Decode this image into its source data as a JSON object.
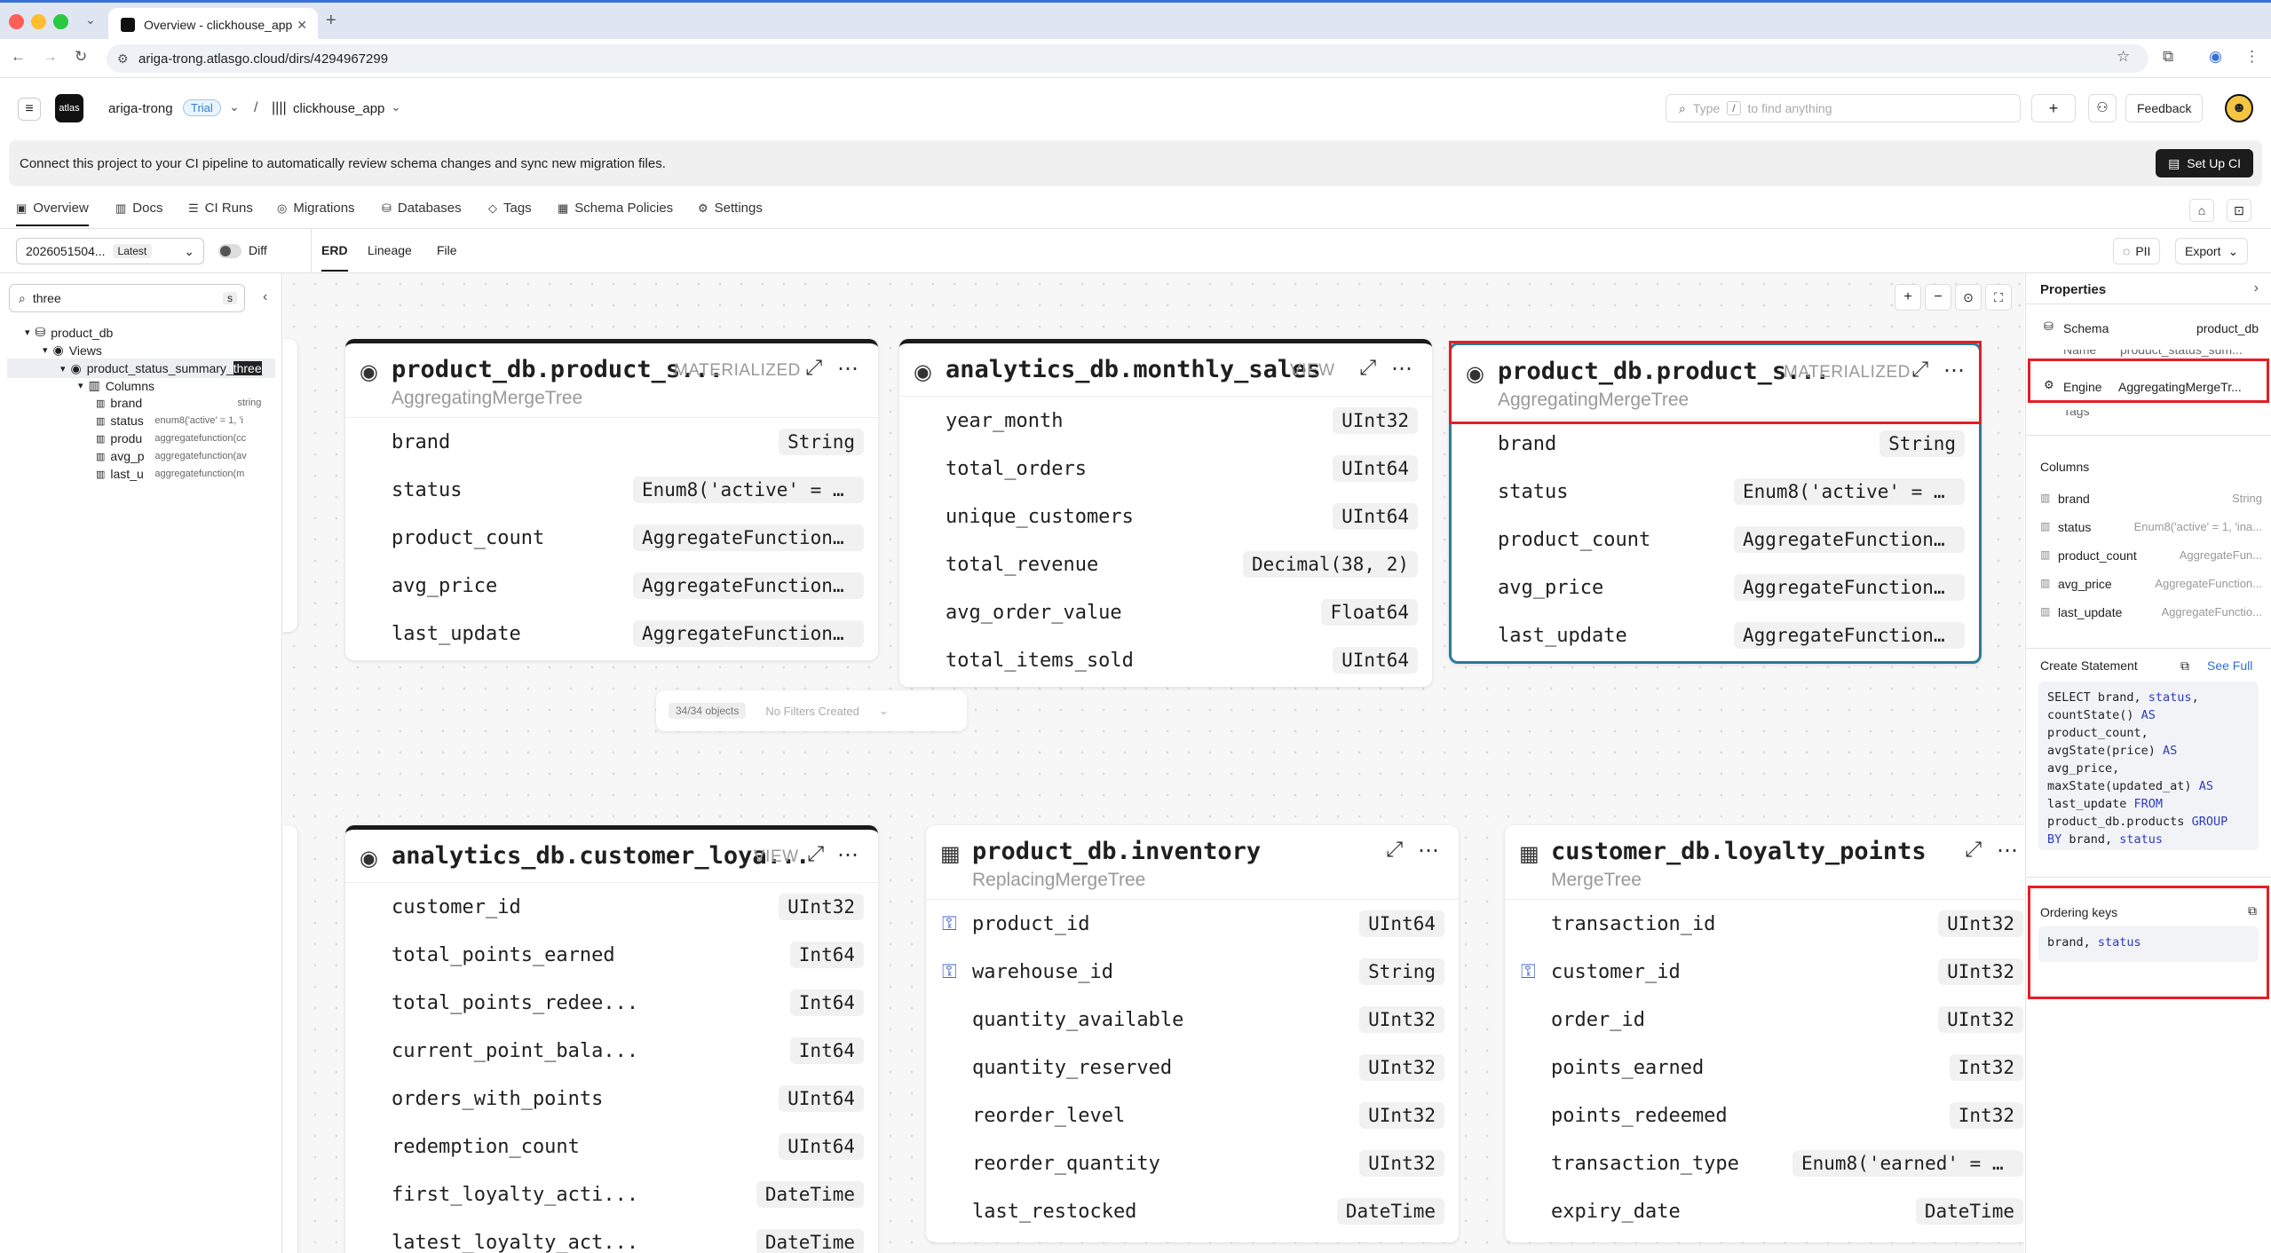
{
  "browser": {
    "tab_title": "Overview - clickhouse_app",
    "url": "ariga-trong.atlasgo.cloud/dirs/4294967299"
  },
  "app": {
    "logo": "atlas",
    "org": "ariga-trong",
    "plan_badge": "Trial",
    "separator": "/",
    "project": "clickhouse_app",
    "search_placeholder_pre": "Type",
    "search_key": "/",
    "search_placeholder_post": "to find anything",
    "plus": "+",
    "feedback": "Feedback"
  },
  "banner": {
    "text": "Connect this project to your CI pipeline to automatically review schema changes and sync new migration files.",
    "button": "Set Up CI"
  },
  "nav": {
    "tabs": [
      {
        "label": "Overview",
        "icon": "overview-icon"
      },
      {
        "label": "Docs",
        "icon": "book-icon"
      },
      {
        "label": "CI Runs",
        "icon": "list-icon"
      },
      {
        "label": "Migrations",
        "icon": "migration-icon"
      },
      {
        "label": "Databases",
        "icon": "database-icon"
      },
      {
        "label": "Tags",
        "icon": "tag-icon"
      },
      {
        "label": "Schema Policies",
        "icon": "policy-icon"
      },
      {
        "label": "Settings",
        "icon": "gear-icon"
      }
    ]
  },
  "toolbar": {
    "version": "2026051504...",
    "version_badge": "Latest",
    "diff_label": "Diff",
    "view_tabs": [
      "ERD",
      "Lineage",
      "File"
    ],
    "pii": "PII",
    "export": "Export"
  },
  "sidebar": {
    "search_value": "three",
    "search_shortcut": "s",
    "tree": {
      "db": "product_db",
      "views": "Views",
      "view_name": "product_status_summary_",
      "view_highlight": "three",
      "columns_label": "Columns",
      "columns": [
        {
          "name": "brand",
          "type": "string"
        },
        {
          "name": "status",
          "type": "enum8('active' = 1, 'i"
        },
        {
          "name": "produ",
          "type": "aggregatefunction(cc"
        },
        {
          "name": "avg_p",
          "type": "aggregatefunction(av"
        },
        {
          "name": "last_u",
          "type": "aggregatefunction(m"
        }
      ]
    }
  },
  "canvas": {
    "filter_count": "34/34 objects",
    "filter_text": "No Filters Created",
    "cards": [
      {
        "title": "product_db.product_s...",
        "kind": "MATERIALIZED",
        "engine": "AggregatingMergeTree",
        "columns": [
          {
            "name": "brand",
            "type": "String"
          },
          {
            "name": "status",
            "type": "Enum8('active' = ..."
          },
          {
            "name": "product_count",
            "type": "AggregateFunction..."
          },
          {
            "name": "avg_price",
            "type": "AggregateFunction..."
          },
          {
            "name": "last_update",
            "type": "AggregateFunction..."
          }
        ]
      },
      {
        "title": "analytics_db.monthly_sales",
        "kind": "VIEW",
        "engine": "",
        "columns": [
          {
            "name": "year_month",
            "type": "UInt32"
          },
          {
            "name": "total_orders",
            "type": "UInt64"
          },
          {
            "name": "unique_customers",
            "type": "UInt64"
          },
          {
            "name": "total_revenue",
            "type": "Decimal(38, 2)"
          },
          {
            "name": "avg_order_value",
            "type": "Float64"
          },
          {
            "name": "total_items_sold",
            "type": "UInt64"
          }
        ]
      },
      {
        "title": "product_db.product_s...",
        "kind": "MATERIALIZED",
        "engine": "AggregatingMergeTree",
        "columns": [
          {
            "name": "brand",
            "type": "String"
          },
          {
            "name": "status",
            "type": "Enum8('active' = ..."
          },
          {
            "name": "product_count",
            "type": "AggregateFunction..."
          },
          {
            "name": "avg_price",
            "type": "AggregateFunction..."
          },
          {
            "name": "last_update",
            "type": "AggregateFunction..."
          }
        ]
      },
      {
        "title": "analytics_db.customer_loya...",
        "kind": "VIEW",
        "engine": "",
        "columns": [
          {
            "name": "customer_id",
            "type": "UInt32"
          },
          {
            "name": "total_points_earned",
            "type": "Int64"
          },
          {
            "name": "total_points_redee...",
            "type": "Int64"
          },
          {
            "name": "current_point_bala...",
            "type": "Int64"
          },
          {
            "name": "orders_with_points",
            "type": "UInt64"
          },
          {
            "name": "redemption_count",
            "type": "UInt64"
          },
          {
            "name": "first_loyalty_acti...",
            "type": "DateTime"
          },
          {
            "name": "latest_loyalty_act...",
            "type": "DateTime"
          }
        ]
      },
      {
        "title": "product_db.inventory",
        "kind": "",
        "engine": "ReplacingMergeTree",
        "columns": [
          {
            "name": "product_id",
            "type": "UInt64",
            "key": true
          },
          {
            "name": "warehouse_id",
            "type": "String",
            "key": true
          },
          {
            "name": "quantity_available",
            "type": "UInt32"
          },
          {
            "name": "quantity_reserved",
            "type": "UInt32"
          },
          {
            "name": "reorder_level",
            "type": "UInt32"
          },
          {
            "name": "reorder_quantity",
            "type": "UInt32"
          },
          {
            "name": "last_restocked",
            "type": "DateTime"
          }
        ]
      },
      {
        "title": "customer_db.loyalty_points",
        "kind": "",
        "engine": "MergeTree",
        "columns": [
          {
            "name": "transaction_id",
            "type": "UInt32"
          },
          {
            "name": "customer_id",
            "type": "UInt32",
            "key": true
          },
          {
            "name": "order_id",
            "type": "UInt32"
          },
          {
            "name": "points_earned",
            "type": "Int32"
          },
          {
            "name": "points_redeemed",
            "type": "Int32"
          },
          {
            "name": "transaction_type",
            "type": "Enum8('earned' = ..."
          },
          {
            "name": "expiry_date",
            "type": "DateTime"
          }
        ]
      }
    ]
  },
  "properties": {
    "title": "Properties",
    "schema_label": "Schema",
    "schema_value": "product_db",
    "name_label": "Name",
    "name_value": "product_status_sum...",
    "engine_label": "Engine",
    "engine_value": "AggregatingMergeTr...",
    "tags_label": "Tags",
    "columns_title": "Columns",
    "columns": [
      {
        "name": "brand",
        "type": "String"
      },
      {
        "name": "status",
        "type": "Enum8('active' = 1, 'ina..."
      },
      {
        "name": "product_count",
        "type": "AggregateFun..."
      },
      {
        "name": "avg_price",
        "type": "AggregateFunction..."
      },
      {
        "name": "last_update",
        "type": "AggregateFunctio..."
      }
    ],
    "create_title": "Create Statement",
    "see_full": "See Full",
    "ordering_title": "Ordering keys"
  }
}
